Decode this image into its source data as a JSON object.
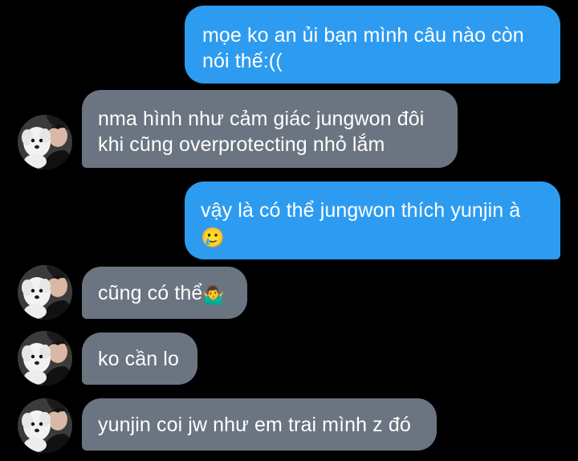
{
  "conversation": {
    "messages": [
      {
        "sender": "me",
        "text": "mọe ko an ủi bạn mình câu nào còn nói thế:(("
      },
      {
        "sender": "other",
        "text": "nma hình như cảm giác jungwon đôi khi cũng overprotecting nhỏ lắm"
      },
      {
        "sender": "me",
        "text": "vậy là có thể jungwon thích yunjin à",
        "emoji": "🥲"
      },
      {
        "sender": "other",
        "text": "cũng có thể",
        "emoji": "🤷‍♂️"
      },
      {
        "sender": "other",
        "text": "ko cần lo"
      },
      {
        "sender": "other",
        "text": "yunjin coi jw như em trai mình z đó"
      }
    ],
    "colors": {
      "background": "#000000",
      "sent_bubble": "#2d9cf0",
      "received_bubble": "#6b7481",
      "text": "#ffffff"
    },
    "avatar_icon": "person-with-white-dog-avatar"
  }
}
